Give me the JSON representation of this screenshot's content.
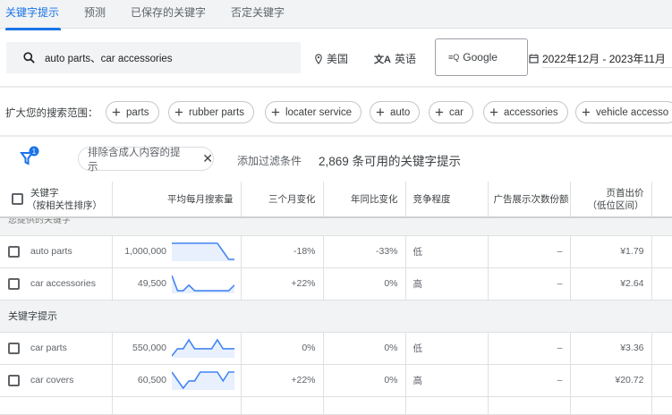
{
  "tabs": [
    {
      "label": "关键字提示",
      "active": true
    },
    {
      "label": "预测"
    },
    {
      "label": "已保存的关键字"
    },
    {
      "label": "否定关键字"
    }
  ],
  "search": {
    "value": "auto parts、car accessories",
    "icon": "search-icon"
  },
  "location": "美国",
  "language": "英语",
  "network": "Google",
  "date_range": "2022年12月 - 2023年11月",
  "broaden": {
    "label": "扩大您的搜索范围：",
    "chips": [
      "parts",
      "rubber parts",
      "locater service",
      "auto",
      "car",
      "accessories",
      "vehicle accesso"
    ]
  },
  "filters": {
    "badge": "1",
    "chip": "排除含成人内容的提示",
    "add": "添加过滤条件",
    "count": "2,869 条可用的关键字提示"
  },
  "table": {
    "headers": {
      "keyword": "关键字",
      "keyword_sub": "（按相关性排序）",
      "volume": "平均每月搜索量",
      "three_month": "三个月变化",
      "yoy": "年同比变化",
      "competition": "竞争程度",
      "impression_share": "广告展示次数份额",
      "bid": "页首出价",
      "bid_sub": "（低位区间）"
    },
    "groups": [
      {
        "label": "您提供的关键字",
        "rows": [
          {
            "keyword": "auto parts",
            "volume": "1,000,000",
            "trend": [
              100,
              100,
              100,
              100,
              100,
              100,
              100,
              100,
              100,
              50,
              0,
              0
            ],
            "three_month": "-18%",
            "yoy": "-33%",
            "competition": "低",
            "impression_share": "–",
            "bid": "¥1.79"
          },
          {
            "keyword": "car accessories",
            "volume": "49,500",
            "trend": [
              100,
              5,
              5,
              40,
              5,
              5,
              5,
              5,
              5,
              5,
              5,
              40
            ],
            "three_month": "+22%",
            "yoy": "0%",
            "competition": "高",
            "impression_share": "–",
            "bid": "¥2.64"
          }
        ]
      },
      {
        "label": "关键字提示",
        "rows": [
          {
            "keyword": "car parts",
            "volume": "550,000",
            "trend": [
              0,
              45,
              45,
              100,
              45,
              45,
              45,
              45,
              100,
              45,
              45,
              45
            ],
            "three_month": "0%",
            "yoy": "0%",
            "competition": "低",
            "impression_share": "–",
            "bid": "¥3.36"
          },
          {
            "keyword": "car covers",
            "volume": "60,500",
            "trend": [
              100,
              50,
              0,
              45,
              45,
              100,
              100,
              100,
              100,
              45,
              100,
              100
            ],
            "three_month": "+22%",
            "yoy": "0%",
            "competition": "高",
            "impression_share": "–",
            "bid": "¥20.72"
          }
        ]
      }
    ]
  },
  "colors": {
    "accent": "#1a73e8",
    "spark_fill": "#e8f0fe"
  }
}
